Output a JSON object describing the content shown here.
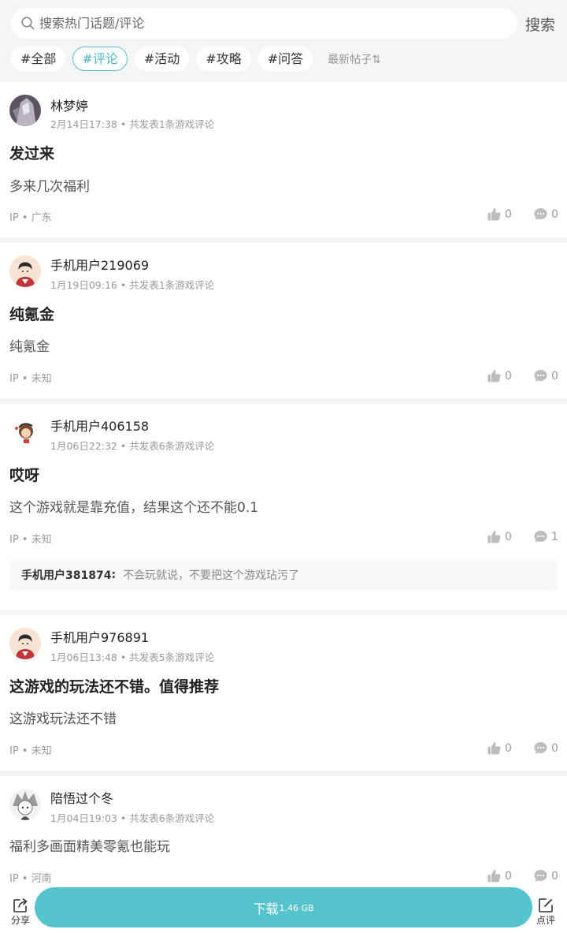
{
  "search": {
    "placeholder": "搜索热门话题/评论",
    "button_label": "搜索"
  },
  "tabs": [
    {
      "label": "#全部",
      "active": false
    },
    {
      "label": "#评论",
      "active": true
    },
    {
      "label": "#活动",
      "active": false
    },
    {
      "label": "#攻略",
      "active": false
    },
    {
      "label": "#问答",
      "active": false
    }
  ],
  "sort": {
    "label": "最新帖子⇅"
  },
  "posts": [
    {
      "username": "林梦婷",
      "date": "2月14日17:38",
      "post_count": "共发表1条游戏评论",
      "title": "发过来",
      "content": "多来几次福利",
      "ip": "IP • 广东",
      "likes": "0",
      "comments": "0"
    },
    {
      "username": "手机用户219069",
      "date": "1月19日09:16",
      "post_count": "共发表1条游戏评论",
      "title": "纯氪金",
      "content": "纯氪金",
      "ip": "IP • 未知",
      "likes": "0",
      "comments": "0"
    },
    {
      "username": "手机用户406158",
      "date": "1月06日22:32",
      "post_count": "共发表6条游戏评论",
      "title": "哎呀",
      "content": "这个游戏就是靠充值，结果这个还不能0.1",
      "ip": "IP • 未知",
      "likes": "0",
      "comments": "1",
      "reply": {
        "user": "手机用户381874",
        "sep": ":",
        "text": "不会玩就说，不要把这个游戏玷污了"
      }
    },
    {
      "username": "手机用户976891",
      "date": "1月06日13:48",
      "post_count": "共发表5条游戏评论",
      "title": "这游戏的玩法还不错。值得推荐",
      "content": "这游戏玩法还不错",
      "ip": "IP • 未知",
      "likes": "0",
      "comments": "0"
    },
    {
      "username": "陪悟过个冬",
      "date": "1月04日19:03",
      "post_count": "共发表6条游戏评论",
      "content": "福利多画面精美零氪也能玩",
      "ip": "IP • 河南",
      "likes": "0",
      "comments": "0"
    }
  ],
  "bottom": {
    "share_label": "分享",
    "download_label": "下载",
    "download_size": "1.46 GB",
    "review_label": "点评"
  },
  "colors": {
    "accent": "#55c4cc",
    "background": "#f4f5f7"
  }
}
